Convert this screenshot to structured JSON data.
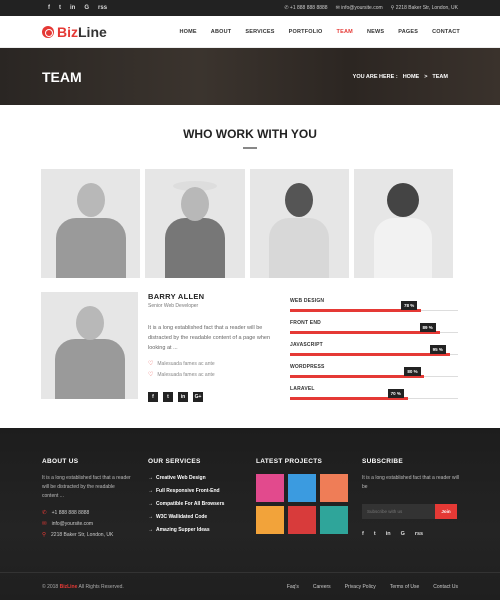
{
  "topbar": {
    "social": [
      "f",
      "t",
      "in",
      "G",
      "rss"
    ],
    "phone": "+1 888 888 8888",
    "email": "info@yoursite.com",
    "address": "2218 Baker Str, London, UK"
  },
  "brand": {
    "logo_prefix": "Biz",
    "logo_suffix": "Line",
    "accent": "#e53935"
  },
  "nav": {
    "items": [
      "HOME",
      "ABOUT",
      "SERVICES",
      "PORTFOLIO",
      "TEAM",
      "NEWS",
      "PAGES",
      "CONTACT"
    ],
    "active": "TEAM"
  },
  "banner": {
    "title": "TEAM",
    "crumb_label": "YOU ARE HERE :",
    "crumb_home": "HOME",
    "crumb_sep": ">",
    "crumb_current": "TEAM"
  },
  "section": {
    "title": "WHO WORK WITH YOU"
  },
  "profile": {
    "name": "BARRY ALLEN",
    "role": "Senior Web Developer",
    "text": "It is a long established fact that a reader will be distracted by the readable content of a page when looking at ...",
    "items": [
      "Malesuada fames ac ante",
      "Malesuada fames ac ante"
    ],
    "social": [
      "f",
      "t",
      "in",
      "G+"
    ]
  },
  "skills": [
    {
      "label": "WEB DESIGN",
      "value": 78,
      "tag": "78 %"
    },
    {
      "label": "FRONT END",
      "value": 89,
      "tag": "89 %"
    },
    {
      "label": "JAVASCRIPT",
      "value": 95,
      "tag": "95 %"
    },
    {
      "label": "WORDPRESS",
      "value": 80,
      "tag": "80 %"
    },
    {
      "label": "LARAVEL",
      "value": 70,
      "tag": "70 %"
    }
  ],
  "footer": {
    "about": {
      "title": "ABOUT US",
      "text": "It is a long established fact that a reader will be distracted by the readable content ...",
      "phone": "+1 888 888 8888",
      "email": "info@yoursite.com",
      "address": "2218 Baker Str, London, UK"
    },
    "services": {
      "title": "OUR SERVICES",
      "items": [
        "Creative Web Design",
        "Full Responsive Front-End",
        "Compatible For All Browsers",
        "W3C Wallidated Code",
        "Amazing Supper Ideas"
      ]
    },
    "projects": {
      "title": "LATEST PROJECTS",
      "colors": [
        "#e24a8d",
        "#3b9be0",
        "#ef7d57",
        "#f2a33a",
        "#d83b3b",
        "#2fa59a"
      ]
    },
    "subscribe": {
      "title": "SUBSCRIBE",
      "text": "It is a long established fact that a reader will be",
      "placeholder": "Subscribe with us",
      "button": "Join",
      "social": [
        "f",
        "t",
        "in",
        "G",
        "rss"
      ]
    },
    "copyright_pre": "© 2018",
    "copyright_brand": "BizLine",
    "copyright_post": "All Rights Reserved.",
    "links": [
      "Faq's",
      "Careers",
      "Privacy Policy",
      "Terms of Use",
      "Contact Us"
    ]
  }
}
